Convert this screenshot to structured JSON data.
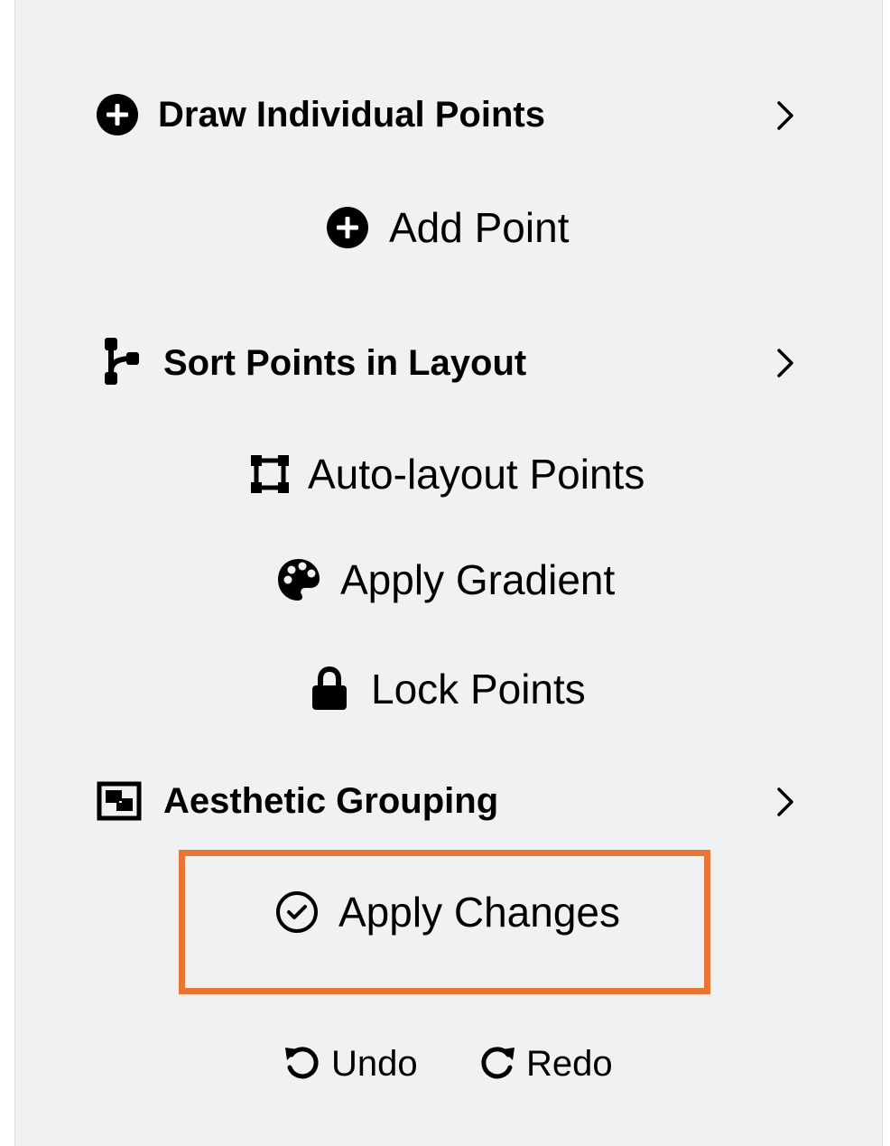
{
  "menu": {
    "sections": [
      {
        "label": "Draw Individual Points",
        "icon": "plus-circle-icon",
        "actions": [
          {
            "label": "Add Point",
            "icon": "plus-circle-icon"
          }
        ]
      },
      {
        "label": "Sort Points in Layout",
        "icon": "branch-icon",
        "actions": [
          {
            "label": "Auto-layout Points",
            "icon": "vector-square-icon"
          },
          {
            "label": "Apply Gradient",
            "icon": "palette-icon"
          },
          {
            "label": "Lock Points",
            "icon": "lock-icon"
          }
        ]
      },
      {
        "label": "Aesthetic Grouping",
        "icon": "object-group-icon",
        "actions": [
          {
            "label": "Apply Changes",
            "icon": "check-circle-icon"
          }
        ]
      }
    ]
  },
  "history": {
    "undo_label": "Undo",
    "redo_label": "Redo"
  },
  "colors": {
    "panel_background": "#f0f1f3",
    "highlight_border": "#e87533",
    "text": "#000000"
  }
}
